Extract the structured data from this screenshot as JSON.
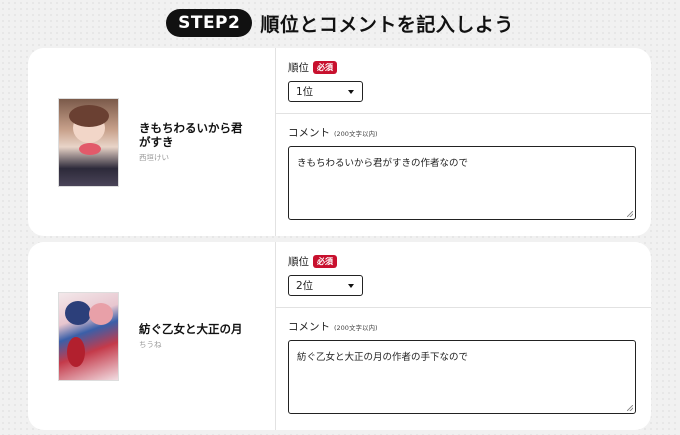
{
  "header": {
    "step": "STEP2",
    "title": "順位とコメントを記入しよう"
  },
  "labels": {
    "rank": "順位",
    "required": "必須",
    "comment": "コメント",
    "comment_note": "(200文字以内)"
  },
  "items": [
    {
      "title": "きもちわるいから君がすき",
      "author": "西垣けい",
      "rank": "1位",
      "comment": "きもちわるいから君がすきの作者なので"
    },
    {
      "title": "紡ぐ乙女と大正の月",
      "author": "ちうね",
      "rank": "2位",
      "comment": "紡ぐ乙女と大正の月の作者の手下なので"
    }
  ]
}
